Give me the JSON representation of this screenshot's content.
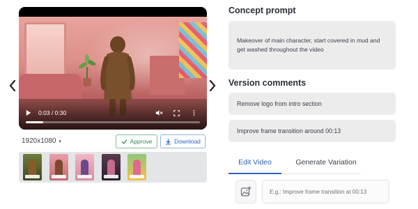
{
  "player": {
    "time": "0:03 / 0:30",
    "progress_fraction": 0.1
  },
  "video": {
    "resolution": "1920x1080",
    "resolution_caret": "▾"
  },
  "actions": {
    "approve_label": "Approve",
    "download_label": "Download"
  },
  "thumbnails": [
    {
      "name": "thumbnail-1"
    },
    {
      "name": "thumbnail-2"
    },
    {
      "name": "thumbnail-3"
    },
    {
      "name": "thumbnail-4"
    },
    {
      "name": "thumbnail-5"
    }
  ],
  "concept": {
    "title": "Concept prompt",
    "text": "Makeover of main character, start covered in mud and get washed throughout the video"
  },
  "comments": {
    "title": "Version comments",
    "items": [
      {
        "text": "Remove logo from intro section"
      },
      {
        "text": "Improve frame transition around 00:13"
      }
    ]
  },
  "tabs": {
    "edit_label": "Edit Video",
    "variation_label": "Generate Variation",
    "active": "edit"
  },
  "edit": {
    "placeholder": "E.g.: Improve frame transition at 00:13",
    "value": ""
  },
  "icons": {
    "prev": "chevron-left-icon",
    "next": "chevron-right-icon",
    "play": "play-icon",
    "mute": "volume-muted-icon",
    "fullscreen": "fullscreen-icon",
    "more": "more-vertical-icon",
    "approve": "check-icon",
    "download": "download-icon",
    "attach": "image-add-icon"
  },
  "colors": {
    "accent_blue": "#2e63b8",
    "approve_green": "#2f8a4f",
    "panel_gray": "#ececed"
  }
}
